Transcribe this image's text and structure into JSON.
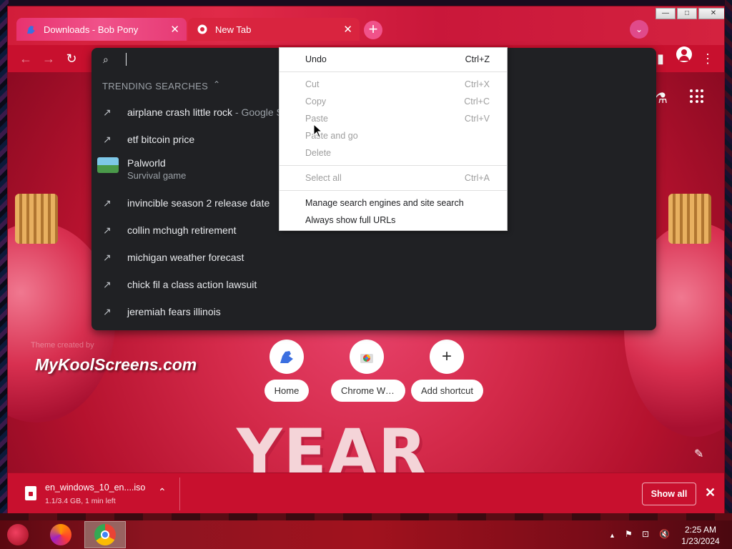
{
  "window": {
    "controls": {
      "minimize": "—",
      "maximize": "□",
      "close": "✕"
    }
  },
  "tabs": [
    {
      "title": "Downloads - Bob Pony",
      "icon": "bob-pony-icon",
      "close": "✕"
    },
    {
      "title": "New Tab",
      "icon": "chrome-icon",
      "close": "✕"
    }
  ],
  "toolbar": {
    "new_tab": "+",
    "tab_search": "⌄",
    "back": "←",
    "forward": "→",
    "reload": "↻",
    "side_panel": "▮",
    "menu": "⋮"
  },
  "omnibox": {
    "value": "",
    "search_icon": "⌕",
    "trending_header": "TRENDING SEARCHES",
    "collapse_icon": "⌃",
    "suggestions": [
      {
        "text": "airplane crash little rock",
        "sub": " - Google Se",
        "icon": "trending-icon"
      },
      {
        "text": "etf bitcoin price",
        "sub": "",
        "icon": "trending-icon"
      },
      {
        "text": "Palworld",
        "sub": "Survival game",
        "icon": "palworld-thumbnail"
      },
      {
        "text": "invincible season 2 release date",
        "sub": "",
        "icon": "trending-icon"
      },
      {
        "text": "collin mchugh retirement",
        "sub": "",
        "icon": "trending-icon"
      },
      {
        "text": "michigan weather forecast",
        "sub": "",
        "icon": "trending-icon"
      },
      {
        "text": "chick fil a class action lawsuit",
        "sub": "",
        "icon": "trending-icon"
      },
      {
        "text": "jeremiah fears illinois",
        "sub": "",
        "icon": "trending-icon"
      }
    ],
    "trend_glyph": "↗"
  },
  "context_menu": {
    "items": [
      {
        "label": "Undo",
        "shortcut": "Ctrl+Z",
        "enabled": true
      },
      {
        "label": "Cut",
        "shortcut": "Ctrl+X",
        "enabled": false
      },
      {
        "label": "Copy",
        "shortcut": "Ctrl+C",
        "enabled": false
      },
      {
        "label": "Paste",
        "shortcut": "Ctrl+V",
        "enabled": false
      },
      {
        "label": "Paste and go",
        "shortcut": "",
        "enabled": false
      },
      {
        "label": "Delete",
        "shortcut": "",
        "enabled": false
      },
      {
        "label": "Select all",
        "shortcut": "Ctrl+A",
        "enabled": false
      },
      {
        "label": "Manage search engines and site search",
        "shortcut": "",
        "enabled": true
      },
      {
        "label": "Always show full URLs",
        "shortcut": "",
        "enabled": true
      }
    ]
  },
  "new_tab_page": {
    "shortcuts": [
      {
        "label": "Home",
        "icon": "bob-pony-icon"
      },
      {
        "label": "Chrome Web ...",
        "icon": "chrome-web-store-icon"
      },
      {
        "label": "Add shortcut",
        "icon": "plus-icon",
        "glyph": "+"
      }
    ],
    "watermark": "MyKoolScreens.com",
    "theme_credit": "Theme created by",
    "background_text": "YEAR",
    "labs_glyph": "⚗",
    "edit_glyph": "✎"
  },
  "download_bar": {
    "file_name": "en_windows_10_en....iso",
    "status": "1.1/3.4 GB, 1 min left",
    "expand": "⌃",
    "show_all": "Show all",
    "close": "✕"
  },
  "taskbar": {
    "time": "2:25 AM",
    "date": "1/23/2024",
    "tray": {
      "up": "▲",
      "flag": "⚑",
      "network": "⊡",
      "volume": "🔇"
    }
  },
  "colors": {
    "chrome_red": "#c8102e",
    "dropdown_bg": "#202124",
    "tab_active": "#f0528a"
  }
}
